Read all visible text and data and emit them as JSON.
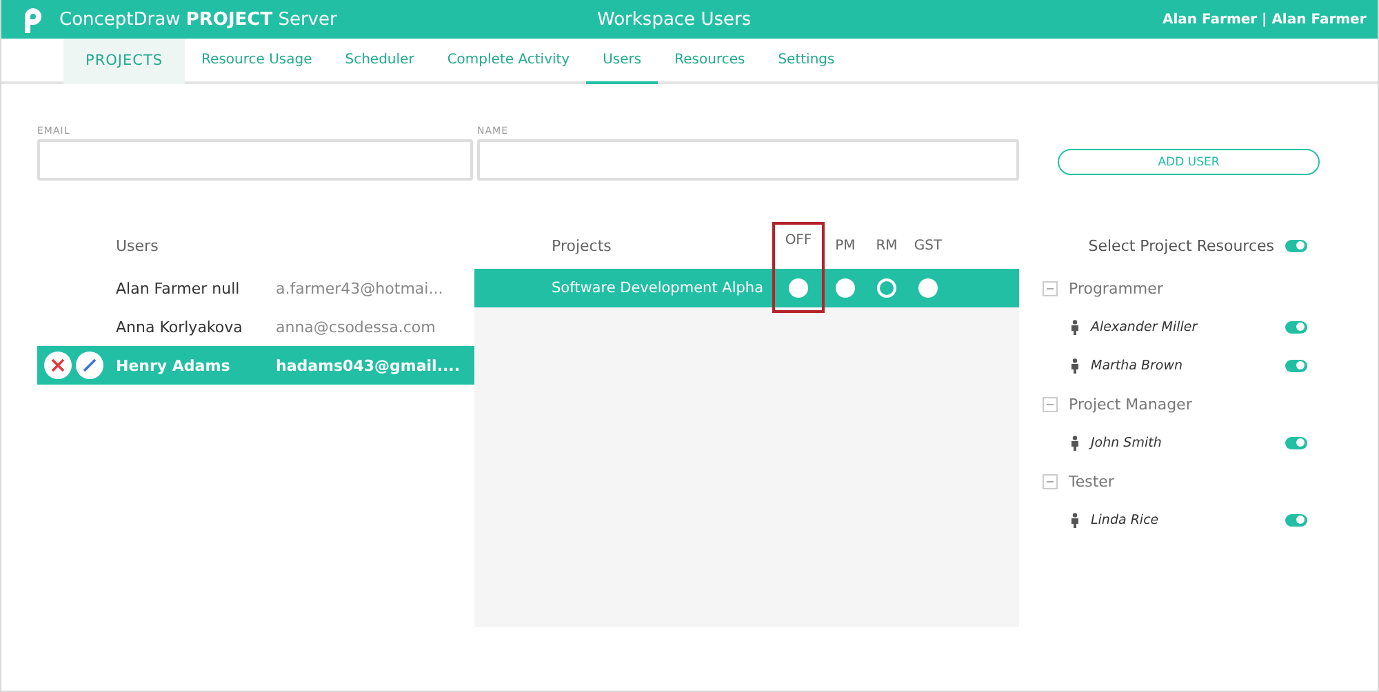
{
  "header": {
    "brand": "ConceptDraw",
    "brand_bold": "PROJECT",
    "brand_suffix": "Server",
    "title": "Workspace Users",
    "user": "Alan Farmer | Alan Farmer"
  },
  "nav": [
    {
      "label": "PROJECTS",
      "kind": "home",
      "selected": false
    },
    {
      "label": "Resource Usage",
      "kind": "link",
      "selected": false
    },
    {
      "label": "Scheduler",
      "kind": "link",
      "selected": false
    },
    {
      "label": "Complete Activity",
      "kind": "link",
      "selected": false
    },
    {
      "label": "Users",
      "kind": "link",
      "selected": true
    },
    {
      "label": "Resources",
      "kind": "link",
      "selected": false
    },
    {
      "label": "Settings",
      "kind": "link",
      "selected": false
    }
  ],
  "form": {
    "email_label": "EMAIL",
    "name_label": "NAME",
    "add_button": "ADD USER"
  },
  "users": {
    "heading": "Users",
    "rows": [
      {
        "name": "Alan Farmer null",
        "email": "a.farmer43@hotmai...",
        "selected": false
      },
      {
        "name": "Anna Korlyakova",
        "email": "anna@csodessa.com",
        "selected": false
      },
      {
        "name": "Henry Adams",
        "email": "hadams043@gmail....",
        "selected": true
      }
    ]
  },
  "projects": {
    "heading": "Projects",
    "roles": [
      {
        "label": "OFF",
        "highlighted": true
      },
      {
        "label": "PM",
        "highlighted": false
      },
      {
        "label": "RM",
        "highlighted": false
      },
      {
        "label": "GST",
        "highlighted": false
      }
    ],
    "rows": [
      {
        "name": "Software Development Alpha",
        "roles": [
          {
            "on": true
          },
          {
            "on": true
          },
          {
            "on": false
          },
          {
            "on": true
          }
        ]
      }
    ]
  },
  "resources": {
    "heading": "Select Project Resources",
    "on": true,
    "groups": [
      {
        "name": "Programmer",
        "expanded": true,
        "children": [
          {
            "name": "Alexander Miller",
            "on": true
          },
          {
            "name": "Martha Brown",
            "on": true
          }
        ]
      },
      {
        "name": "Project Manager",
        "expanded": true,
        "children": [
          {
            "name": "John Smith",
            "on": true
          }
        ]
      },
      {
        "name": "Tester",
        "expanded": true,
        "children": [
          {
            "name": "Linda Rice",
            "on": true
          }
        ]
      }
    ]
  }
}
